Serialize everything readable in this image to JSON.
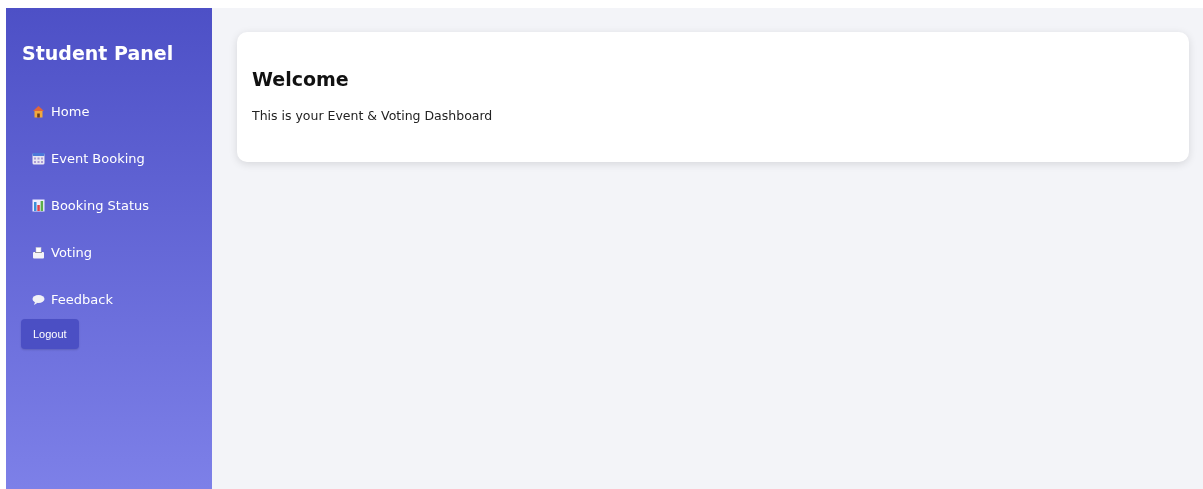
{
  "sidebar": {
    "title": "Student Panel",
    "items": [
      {
        "label": "Home"
      },
      {
        "label": "Event Booking"
      },
      {
        "label": "Booking Status"
      },
      {
        "label": "Voting"
      },
      {
        "label": "Feedback"
      }
    ],
    "logout": "Logout"
  },
  "card": {
    "heading": "Welcome",
    "text": "This is your Event & Voting Dashboard"
  }
}
